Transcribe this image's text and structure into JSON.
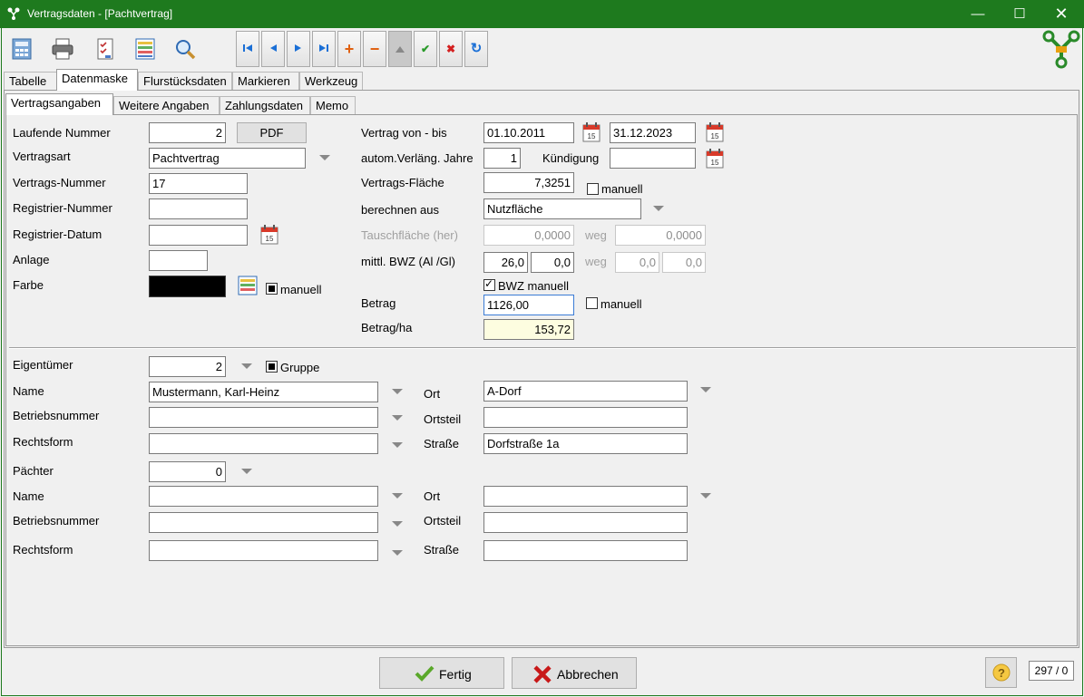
{
  "window": {
    "title": "Vertragsdaten - [Pachtvertrag]"
  },
  "main_tabs": [
    "Tabelle",
    "Datenmaske",
    "Flurstücksdaten",
    "Markieren",
    "Werkzeug"
  ],
  "sub_tabs": [
    "Vertragsangaben",
    "Weitere Angaben",
    "Zahlungsdaten",
    "Memo"
  ],
  "left": {
    "laufende_nummer": {
      "label": "Laufende Nummer",
      "value": "2"
    },
    "pdf_label": "PDF",
    "vertragsart": {
      "label": "Vertragsart",
      "value": "Pachtvertrag"
    },
    "vertrags_nummer": {
      "label": "Vertrags-Nummer",
      "value": "17"
    },
    "registrier_nummer": {
      "label": "Registrier-Nummer",
      "value": ""
    },
    "registrier_datum": {
      "label": "Registrier-Datum",
      "value": ""
    },
    "anlage": {
      "label": "Anlage",
      "value": ""
    },
    "farbe": {
      "label": "Farbe",
      "color": "#000000",
      "manuell": "manuell"
    }
  },
  "right": {
    "vertrag_von_bis": {
      "label": "Vertrag von - bis",
      "von": "01.10.2011",
      "bis": "31.12.2023"
    },
    "verlaeng": {
      "label": "autom.Verläng. Jahre",
      "value": "1"
    },
    "kuendigung": {
      "label": "Kündigung",
      "value": ""
    },
    "flaeche": {
      "label": "Vertrags-Fläche",
      "value": "7,3251",
      "manuell": "manuell"
    },
    "berechnen": {
      "label": "berechnen aus",
      "value": "Nutzfläche"
    },
    "tausch": {
      "label": "Tauschfläche (her)",
      "her": "0,0000",
      "weg_label": "weg",
      "weg": "0,0000"
    },
    "bwz": {
      "label": "mittl. BWZ (Al /Gl)",
      "al": "26,0",
      "gl": "0,0",
      "weg_label": "weg",
      "weg_al": "0,0",
      "weg_gl": "0,0"
    },
    "bwz_manuell": "BWZ manuell",
    "betrag": {
      "label": "Betrag",
      "value": "1126,00",
      "manuell": "manuell"
    },
    "betrag_ha": {
      "label": "Betrag/ha",
      "value": "153,72"
    }
  },
  "eigentuemer": {
    "label": "Eigentümer",
    "value": "2",
    "gruppe": "Gruppe",
    "name": {
      "label": "Name",
      "value": "Mustermann, Karl-Heinz"
    },
    "betriebsnummer": {
      "label": "Betriebsnummer",
      "value": ""
    },
    "rechtsform": {
      "label": "Rechtsform",
      "value": ""
    },
    "ort": {
      "label": "Ort",
      "value": "A-Dorf"
    },
    "ortsteil": {
      "label": "Ortsteil",
      "value": ""
    },
    "strasse": {
      "label": "Straße",
      "value": "Dorfstraße 1a"
    }
  },
  "paechter": {
    "label": "Pächter",
    "value": "0",
    "name": {
      "label": "Name",
      "value": ""
    },
    "betriebsnummer": {
      "label": "Betriebsnummer",
      "value": ""
    },
    "rechtsform": {
      "label": "Rechtsform",
      "value": ""
    },
    "ort": {
      "label": "Ort",
      "value": ""
    },
    "ortsteil": {
      "label": "Ortsteil",
      "value": ""
    },
    "strasse": {
      "label": "Straße",
      "value": ""
    }
  },
  "footer": {
    "fertig": "Fertig",
    "abbrechen": "Abbrechen",
    "record": "297 / 0"
  },
  "calendar_day": "15",
  "colors": {
    "titlebar": "#1e7a1e",
    "accent_nav": "#1a6fd6",
    "add": "#e06010",
    "ok": "#2a9a2a",
    "cancel": "#d42020"
  }
}
